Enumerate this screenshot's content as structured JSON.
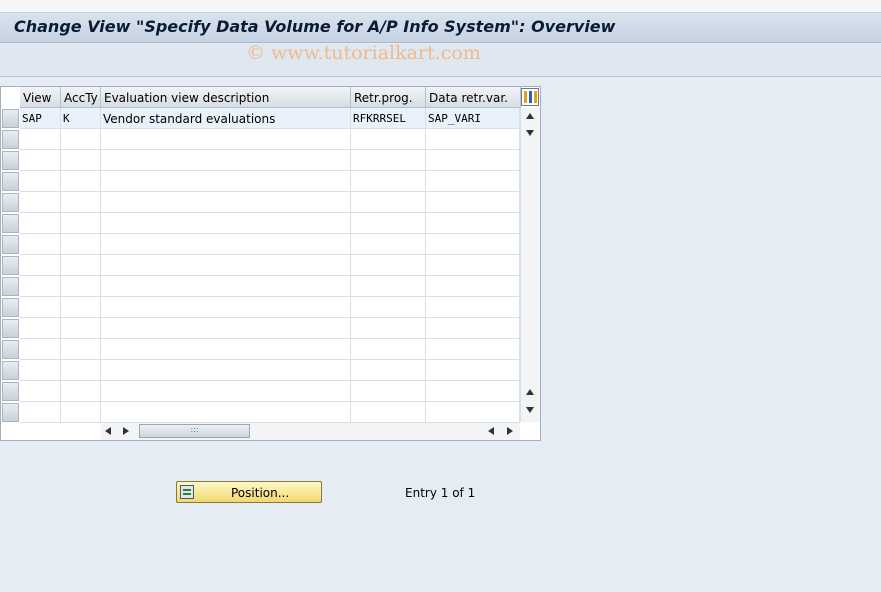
{
  "window": {
    "title": "Change View \"Specify Data Volume for A/P Info System\": Overview",
    "watermark": "© www.tutorialkart.com"
  },
  "table": {
    "columns": [
      "View",
      "AccTy",
      "Evaluation view description",
      "Retr.prog.",
      "Data retr.var."
    ],
    "rows": [
      [
        "SAP",
        "K",
        "Vendor standard evaluations",
        "RFKRRSEL",
        "SAP_VARI"
      ]
    ],
    "thumb_grip": ":::"
  },
  "footer": {
    "position_button": "Position...",
    "entry_text": "Entry 1 of 1"
  }
}
